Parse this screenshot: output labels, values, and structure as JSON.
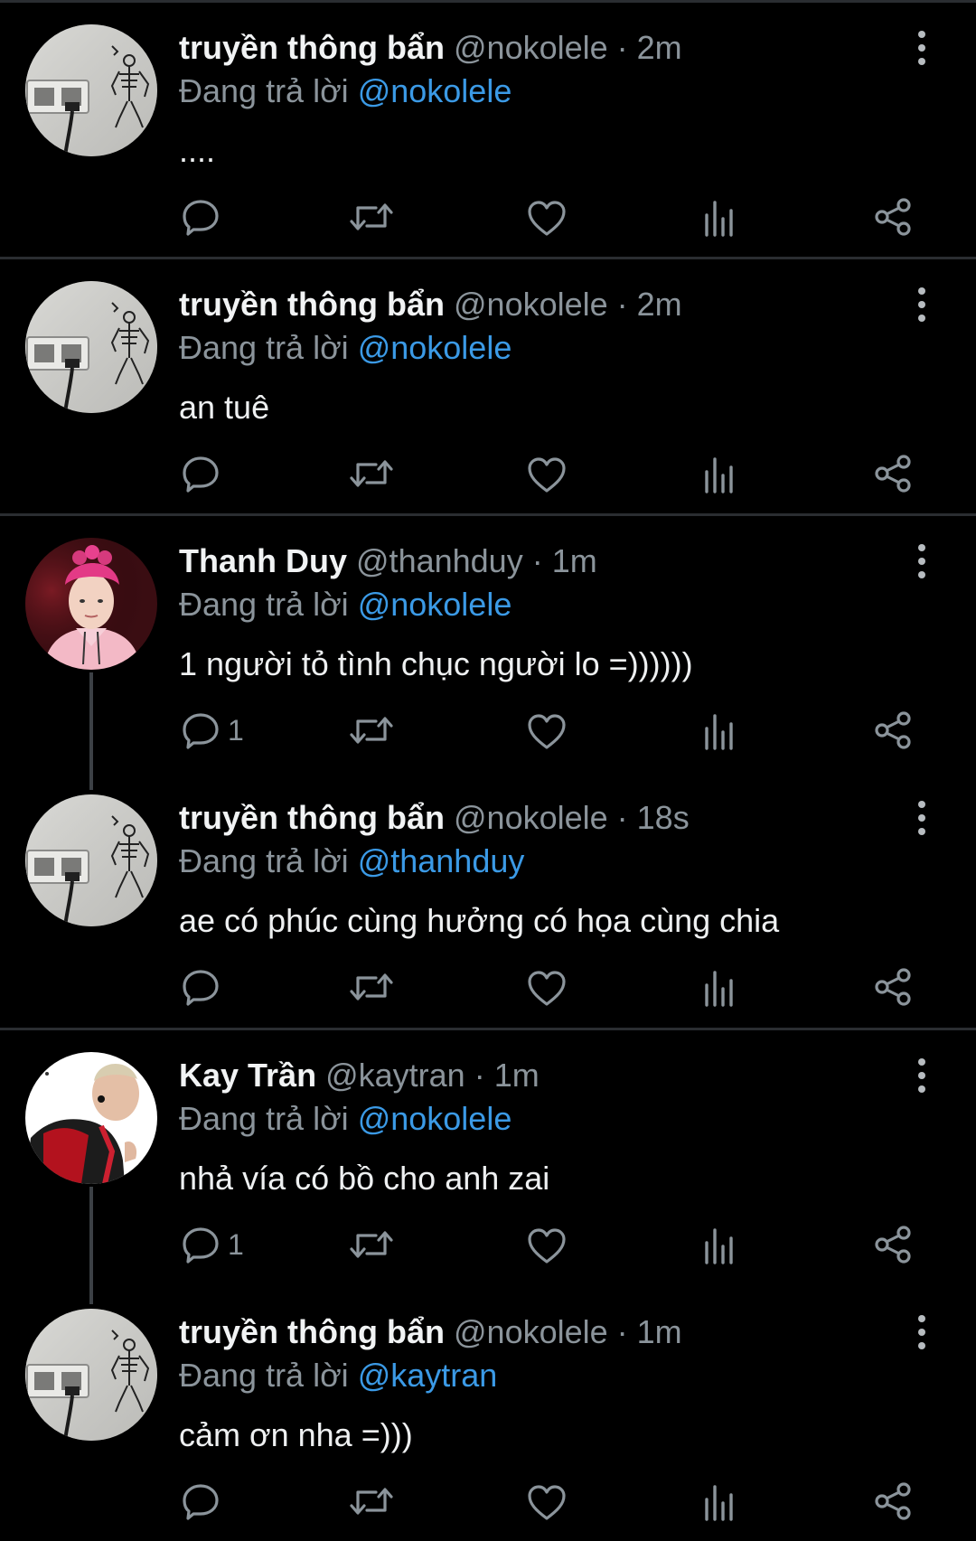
{
  "colors": {
    "background": "#000000",
    "mention": "#3b9ae6",
    "muted": "#8b949b",
    "icon": "#8b949b",
    "divider": "#2a2d31"
  },
  "tweets": [
    {
      "name": "truyền thông bẩn",
      "handle": "@nokolele",
      "time": "· 2m",
      "replying_prefix": "Đang trả lời ",
      "replying_to": "@nokolele",
      "text": "....",
      "reply_count": ""
    },
    {
      "name": "truyền thông bẩn",
      "handle": "@nokolele",
      "time": "· 2m",
      "replying_prefix": "Đang trả lời ",
      "replying_to": "@nokolele",
      "text": "an tuê",
      "reply_count": ""
    },
    {
      "name": "Thanh Duy",
      "handle": "@thanhduy",
      "time": "· 1m",
      "replying_prefix": "Đang trả lời ",
      "replying_to": "@nokolele",
      "text": "1 người tỏ tình chục người lo =))))))",
      "reply_count": "1"
    },
    {
      "name": "truyền thông bẩn",
      "handle": "@nokolele",
      "time": "· 18s",
      "replying_prefix": "Đang trả lời ",
      "replying_to": "@thanhduy",
      "text": "ae có phúc cùng hưởng có họa cùng chia",
      "reply_count": ""
    },
    {
      "name": "Kay Trần",
      "handle": "@kaytran",
      "time": "· 1m",
      "replying_prefix": "Đang trả lời ",
      "replying_to": "@nokolele",
      "text": "nhả vía có bồ cho anh zai",
      "reply_count": "1"
    },
    {
      "name": "truyền thông bẩn",
      "handle": "@nokolele",
      "time": "· 1m",
      "replying_prefix": "Đang trả lời ",
      "replying_to": "@kaytran",
      "text": "cảm ơn nha =)))",
      "reply_count": ""
    }
  ],
  "icons": {
    "reply": "reply-icon",
    "retweet": "retweet-icon",
    "like": "heart-icon",
    "views": "views-chart-icon",
    "share": "share-icon",
    "more": "more-vertical-icon"
  }
}
